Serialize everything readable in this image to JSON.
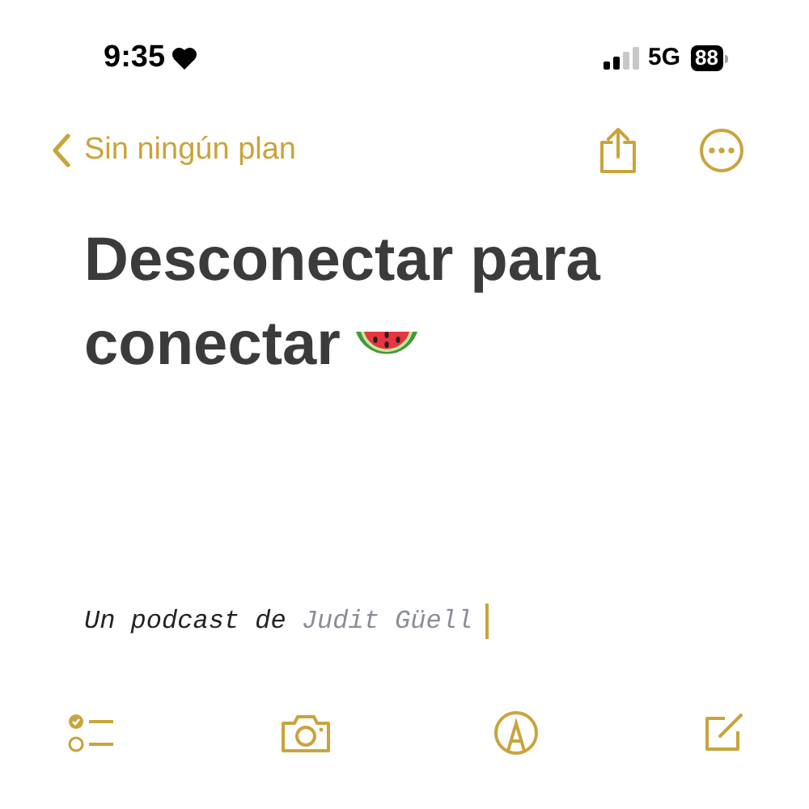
{
  "status_bar": {
    "time": "9:35",
    "network": "5G",
    "battery": "88"
  },
  "nav": {
    "back_label": "Sin ningún plan"
  },
  "note": {
    "title_lines": [
      "Desconectar para",
      "conectar"
    ],
    "byline": "Un podcast de",
    "author": "Judit Güell"
  }
}
